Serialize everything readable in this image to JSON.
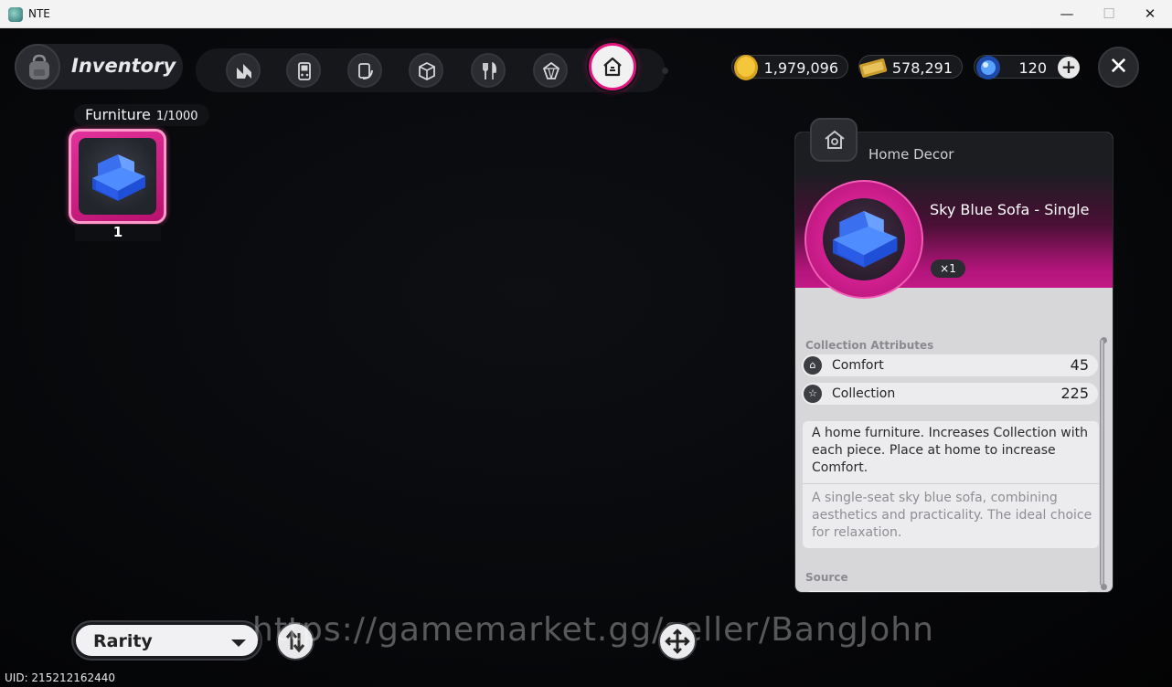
{
  "window": {
    "title": "NTE",
    "minimize": "—",
    "maximize": "☐",
    "close": "✕"
  },
  "header": {
    "title": "Inventory",
    "tabs": [
      {
        "icon": "n-logo-icon"
      },
      {
        "icon": "gameboy-icon"
      },
      {
        "icon": "card-icon"
      },
      {
        "icon": "box-icon"
      },
      {
        "icon": "fork-knife-icon"
      },
      {
        "icon": "gem-icon"
      },
      {
        "icon": "home-icon",
        "active": true
      }
    ],
    "currencies": [
      {
        "icon": "gold-coin-icon",
        "amount": "1,979,096"
      },
      {
        "icon": "ticket-icon",
        "amount": "578,291"
      },
      {
        "icon": "blue-orb-icon",
        "amount": "120"
      }
    ],
    "close_label": "✕"
  },
  "grid": {
    "category": "Furniture",
    "count": "1/1000",
    "items": [
      {
        "icon": "sofa-icon",
        "quantity": "1",
        "selected": true
      }
    ]
  },
  "detail": {
    "category": "Home Decor",
    "name": "Sky Blue Sofa - Single",
    "quantity": "×1",
    "attributes_title": "Collection Attributes",
    "attributes": [
      {
        "label": "Comfort",
        "value": "45"
      },
      {
        "label": "Collection",
        "value": "225"
      }
    ],
    "description": "A home furniture. Increases Collection with each piece. Place at home to increase Comfort.",
    "flavor": "A single-seat sky blue sofa, combining aesthetics and practicality. The ideal choice for relaxation.",
    "source_title": "Source"
  },
  "footer": {
    "sort_label": "Rarity",
    "watermark": "https://gamemarket.gg/seller/BangJohn",
    "uid": "UID: 215212162440"
  },
  "colors": {
    "accent": "#e0157f",
    "panel_bg": "#d7d7da",
    "background": "#050608"
  }
}
